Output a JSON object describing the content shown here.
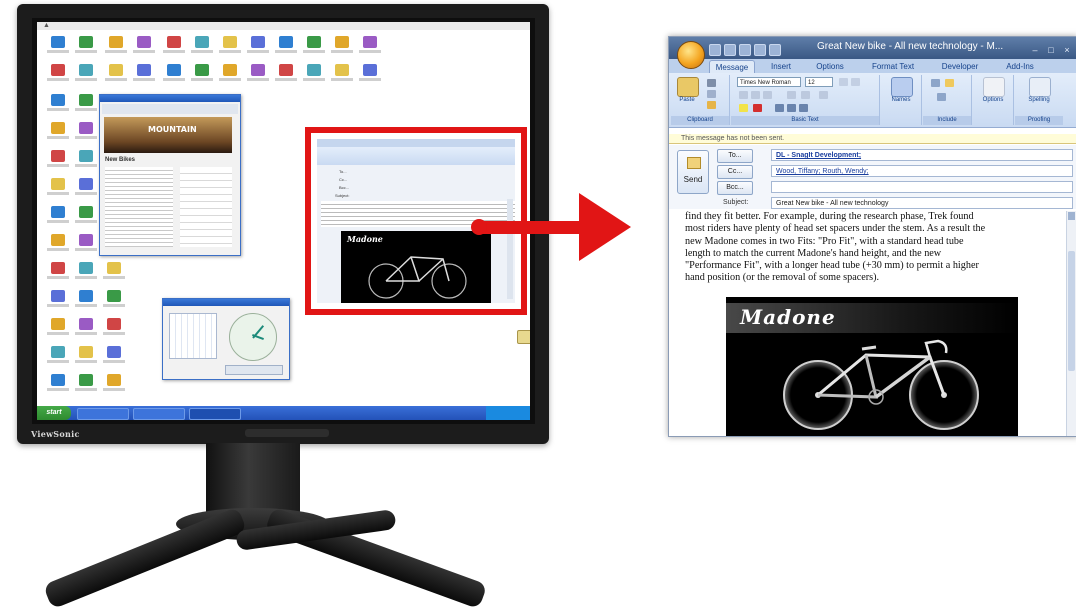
{
  "monitor": {
    "brand": "ViewSonic"
  },
  "desktop": {
    "start_label": "start",
    "highlight": {
      "to_label": "To...",
      "cc_label": "Cc...",
      "bcc_label": "Bcc...",
      "subject_label": "Subject:",
      "bike_brand": "Madone"
    },
    "mini_window_heading": "MOUNTAIN",
    "mini_window_subheading": "New Bikes"
  },
  "outlook": {
    "title": "Great New bike - All new technology - M...",
    "window_controls": [
      "–",
      "□",
      "×"
    ],
    "tabs": [
      "Message",
      "Insert",
      "Options",
      "Format Text",
      "Developer",
      "Add-Ins"
    ],
    "active_tab": "Message",
    "ribbon": {
      "paste_label": "Paste",
      "font_name": "Times New Roman",
      "font_size": "12",
      "names_label": "Names",
      "options_label": "Options",
      "spelling_label": "Spelling",
      "groups": [
        "Clipboard",
        "Basic Text",
        "Include",
        "Proofing"
      ]
    },
    "info_bar": "This message has not been sent.",
    "send_label": "Send",
    "to_button": "To...",
    "cc_button": "Cc...",
    "bcc_button": "Bcc...",
    "to_value": "DL - SnagIt Development;",
    "cc_value": "Wood, Tiffany; Routh, Wendy;",
    "bcc_value": "",
    "subject_label": "Subject:",
    "subject_value": "Great New bike - All new technology",
    "body_lines": [
      "find they fit better. For example, during the research phase, Trek found",
      "most riders have plenty of head set spacers under the stem. As a result the",
      "new Madone comes in two Fits: \"Pro Fit\", with a standard head tube",
      "length to match the current Madone's hand height, and the new",
      "\"Performance Fit\", with a longer head tube (+30 mm) to permit a higher",
      "hand position (or the removal of some spacers)."
    ],
    "image_caption": "Madone"
  },
  "colors": {
    "highlight": "#e11515",
    "outlook_titlebar": "#4a6a96",
    "ribbon": "#d6e3f5",
    "xp_taskbar": "#2e5fc9"
  }
}
